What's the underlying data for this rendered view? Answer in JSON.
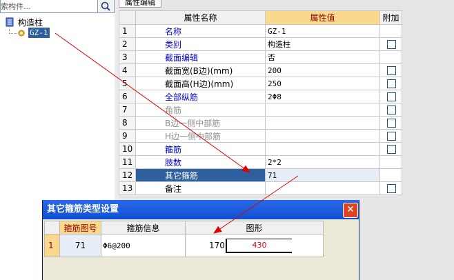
{
  "tree": {
    "search_placeholder": "索构件...",
    "root_label": "构造柱",
    "child_label": "GZ-1"
  },
  "tab_label": "属性编辑",
  "prop_table": {
    "header_name": "属性名称",
    "header_value": "属性值",
    "header_extra": "附加",
    "rows": [
      {
        "num": "1",
        "name": "名称",
        "value": "GZ-1",
        "style": "blue",
        "checkbox": false
      },
      {
        "num": "2",
        "name": "类别",
        "value": "构造柱",
        "style": "blue",
        "checkbox": true
      },
      {
        "num": "3",
        "name": "截面编辑",
        "value": "否",
        "style": "blue",
        "checkbox": false
      },
      {
        "num": "4",
        "name": "截面宽(B边)(mm)",
        "value": "200",
        "style": "blk",
        "checkbox": true
      },
      {
        "num": "5",
        "name": "截面高(H边)(mm)",
        "value": "250",
        "style": "blk",
        "checkbox": true
      },
      {
        "num": "6",
        "name": "全部纵筋",
        "value": "2Φ8",
        "style": "blue",
        "checkbox": true
      },
      {
        "num": "7",
        "name": "角筋",
        "value": "",
        "style": "gray",
        "checkbox": true
      },
      {
        "num": "8",
        "name": "B边一侧中部筋",
        "value": "",
        "style": "gray",
        "checkbox": true
      },
      {
        "num": "9",
        "name": "H边一侧中部筋",
        "value": "",
        "style": "gray",
        "checkbox": true
      },
      {
        "num": "10",
        "name": "箍筋",
        "value": "",
        "style": "blue",
        "checkbox": true
      },
      {
        "num": "11",
        "name": "肢数",
        "value": "2*2",
        "style": "blue",
        "checkbox": false
      },
      {
        "num": "12",
        "name": "其它箍筋",
        "value": "71",
        "style": "sel",
        "checkbox": false
      },
      {
        "num": "13",
        "name": "备注",
        "value": "",
        "style": "blk",
        "checkbox": true
      }
    ]
  },
  "dialog": {
    "title": "其它箍筋类型设置",
    "close_glyph": "✕",
    "col_num": "",
    "col_fig_no": "箍筋图号",
    "col_info": "箍筋信息",
    "col_shape": "图形",
    "row": {
      "num": "1",
      "fig_no": "71",
      "info": "Φ6@200",
      "shape_left": "170",
      "shape_len": "430"
    }
  },
  "colors": {
    "accent_header": "#fbd98c",
    "selected_row": "#2e5f9e",
    "arrow": "#e00000",
    "titlebar": "#0f4fd2"
  }
}
